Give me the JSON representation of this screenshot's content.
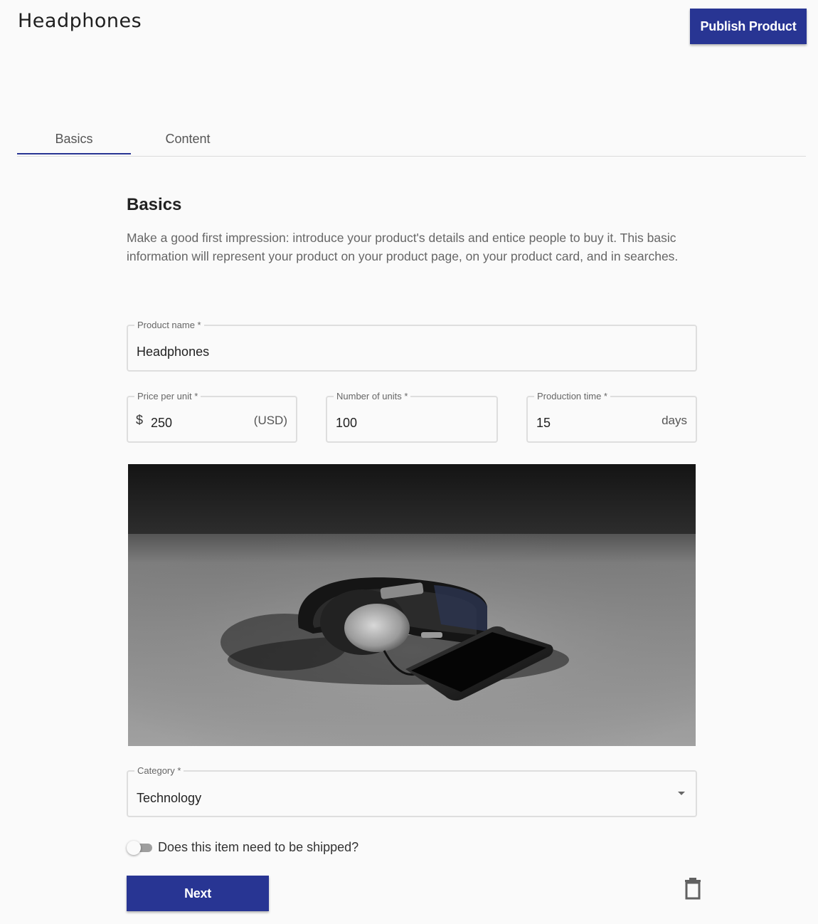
{
  "header": {
    "title": "Headphones",
    "publish_label": "Publish Product"
  },
  "tabs": [
    {
      "label": "Basics",
      "active": true
    },
    {
      "label": "Content",
      "active": false
    }
  ],
  "basics": {
    "title": "Basics",
    "description": "Make a good first impression: introduce your product's details and entice people to buy it. This basic information will represent your product on your product page, on your product card, and in searches."
  },
  "form": {
    "product_name": {
      "label": "Product name *",
      "value": "Headphones"
    },
    "price": {
      "label": "Price per unit *",
      "prefix": "$",
      "value": "250",
      "suffix": "(USD)"
    },
    "units": {
      "label": "Number of units *",
      "value": "100"
    },
    "production_time": {
      "label": "Production time *",
      "value": "15",
      "suffix": "days"
    },
    "category": {
      "label": "Category *",
      "value": "Technology"
    },
    "shipping": {
      "label": "Does this item need to be shipped?",
      "enabled": false
    }
  },
  "image": {
    "subject": "headphones-photo"
  },
  "actions": {
    "next_label": "Next",
    "delete_icon": "trash-icon"
  },
  "colors": {
    "primary": "#283593",
    "background": "#fafafa",
    "border": "#dedede"
  }
}
